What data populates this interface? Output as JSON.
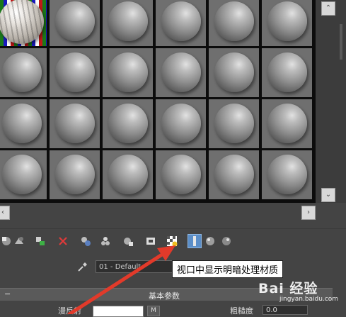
{
  "material_slots": [
    {
      "selected": true,
      "preview": "striped-sphere-checker"
    },
    {
      "selected": false,
      "preview": "sphere"
    },
    {
      "selected": false,
      "preview": "sphere"
    },
    {
      "selected": false,
      "preview": "sphere"
    },
    {
      "selected": false,
      "preview": "sphere"
    },
    {
      "selected": false,
      "preview": "sphere"
    },
    {
      "selected": false,
      "preview": "sphere"
    },
    {
      "selected": false,
      "preview": "sphere"
    },
    {
      "selected": false,
      "preview": "sphere"
    },
    {
      "selected": false,
      "preview": "sphere"
    },
    {
      "selected": false,
      "preview": "sphere"
    },
    {
      "selected": false,
      "preview": "sphere"
    },
    {
      "selected": false,
      "preview": "sphere"
    },
    {
      "selected": false,
      "preview": "sphere"
    },
    {
      "selected": false,
      "preview": "sphere"
    },
    {
      "selected": false,
      "preview": "sphere"
    },
    {
      "selected": false,
      "preview": "sphere"
    },
    {
      "selected": false,
      "preview": "sphere"
    },
    {
      "selected": false,
      "preview": "sphere"
    },
    {
      "selected": false,
      "preview": "sphere"
    },
    {
      "selected": false,
      "preview": "sphere"
    },
    {
      "selected": false,
      "preview": "sphere"
    },
    {
      "selected": false,
      "preview": "sphere"
    },
    {
      "selected": false,
      "preview": "sphere"
    }
  ],
  "toolbar": {
    "tools": [
      {
        "icon": "get-material-icon"
      },
      {
        "icon": "put-to-scene-icon"
      },
      {
        "icon": "assign-to-selection-icon"
      },
      {
        "icon": "reset-map-icon"
      },
      {
        "icon": "make-unique-icon"
      },
      {
        "icon": "put-to-library-icon"
      },
      {
        "icon": "material-id-channel-icon"
      },
      {
        "icon": "show-map-icon"
      },
      {
        "icon": "show-shaded-material-icon"
      },
      {
        "icon": "show-end-result-icon"
      },
      {
        "icon": "go-to-parent-icon"
      },
      {
        "icon": "go-forward-icon"
      }
    ],
    "active_tool": "show-shaded-material-icon",
    "active_color": "#5b8ec8"
  },
  "material_name": "01 - Default",
  "tooltip": "视口中显示明暗处理材质",
  "rollout": {
    "title": "基本参数",
    "diffuse_label": "漫反射",
    "roughness_label": "粗糙度",
    "roughness_value": "0.0",
    "map_button_label": "M"
  },
  "annotation": {
    "arrow_color": "#e23a2a"
  },
  "watermark": {
    "brand": "Bai 经验",
    "sub": "jingyan.baidu.com"
  }
}
